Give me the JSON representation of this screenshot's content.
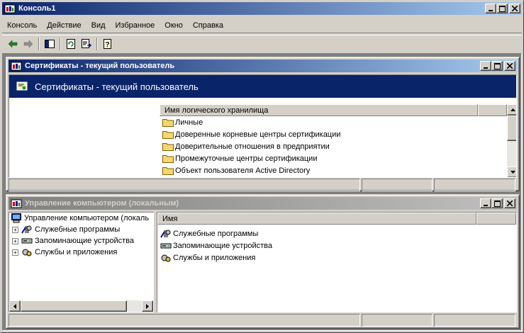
{
  "main_window": {
    "title": "Консоль1"
  },
  "menu": {
    "items": [
      {
        "label": "Консоль"
      },
      {
        "label": "Действие"
      },
      {
        "label": "Вид"
      },
      {
        "label": "Избранное"
      },
      {
        "label": "Окно"
      },
      {
        "label": "Справка"
      }
    ]
  },
  "toolbar": {
    "icons": [
      "back-arrow-icon",
      "forward-arrow-icon",
      "show-hide-tree-icon",
      "refresh-icon",
      "export-list-icon",
      "help-icon"
    ]
  },
  "cert_window": {
    "title": "Сертификаты - текущий пользователь",
    "header": "Сертификаты - текущий пользователь",
    "column": "Имя логического хранилища",
    "rows": [
      "Личные",
      "Доверенные корневые центры сертификации",
      "Доверительные отношения в предприятии",
      "Промежуточные центры сертификации",
      "Объект пользователя Active Directory"
    ]
  },
  "comp_window": {
    "title": "Управление компьютером (локальным)",
    "tree_root": "Управление компьютером (локаль",
    "tree_items": [
      "Служебные программы",
      "Запоминающие устройства",
      "Службы и приложения"
    ],
    "column": "Имя",
    "list_items": [
      "Служебные программы",
      "Запоминающие устройства",
      "Службы и приложения"
    ]
  },
  "colors": {
    "active_title": "#0a246a",
    "inactive_title": "#808080",
    "folder": "#f5d76e"
  }
}
